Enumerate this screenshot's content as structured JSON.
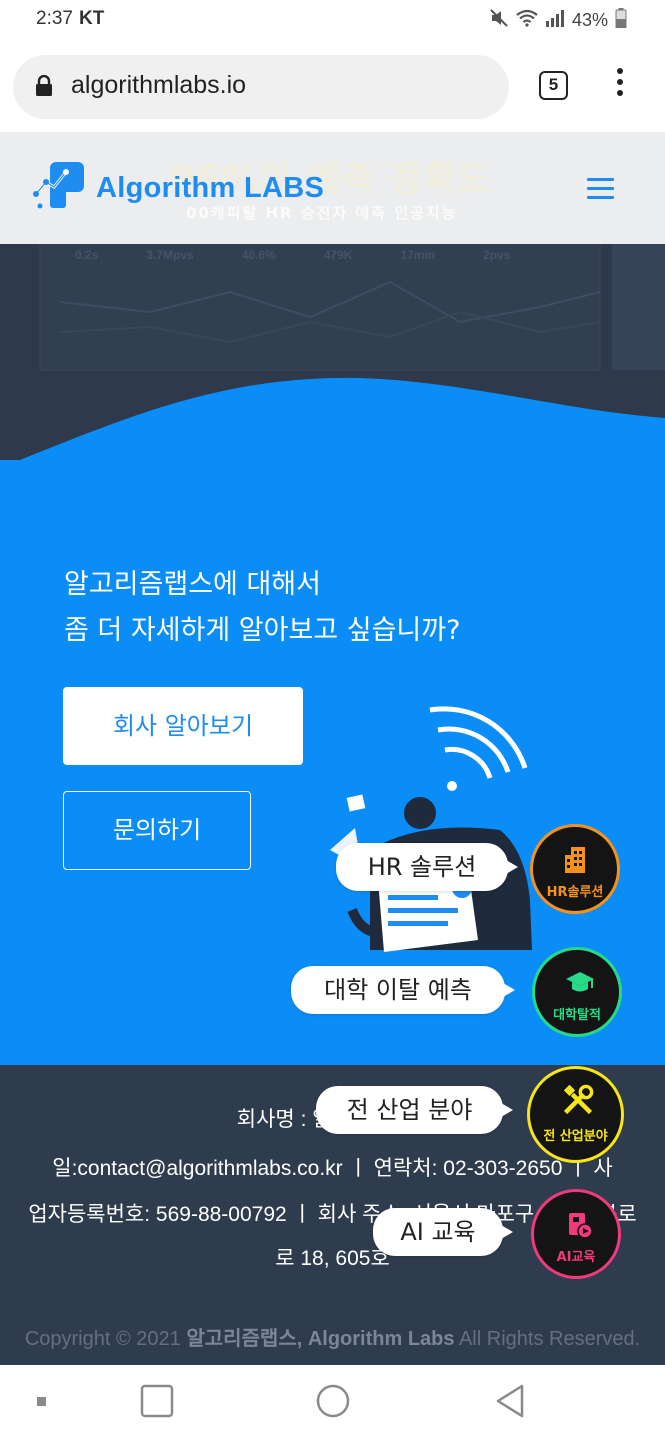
{
  "status_bar": {
    "time": "2:37",
    "carrier": "KT",
    "battery": "43%"
  },
  "browser": {
    "url": "algorithmlabs.io",
    "tab_count": "5"
  },
  "header": {
    "logo_text": "Algorithm LABS",
    "ghost_headline": "96%의 예측 정확도",
    "ghost_subtitle": "00캐피탈 HR 승진자 예측 인공지능",
    "bg_stats": [
      "0.2s",
      "3.7Mpvs",
      "40.6%",
      "479K",
      "17min",
      "2pvs"
    ]
  },
  "about": {
    "line1": "알고리즘랩스에 대해서",
    "line2": "좀 더 자세하게 알아보고 싶습니까?",
    "about_button": "회사 알아보기",
    "contact_button": "문의하기"
  },
  "floating_menu": [
    {
      "tooltip": "HR 솔루션",
      "label": "HR솔루션",
      "icon": "building-icon",
      "color": "#f5921f"
    },
    {
      "tooltip": "대학 이탈 예측",
      "label": "대학탈적",
      "icon": "graduation-cap-icon",
      "color": "#28d988"
    },
    {
      "tooltip": "전 산업 분야",
      "label": "전 산업분야",
      "icon": "tools-icon",
      "color": "#f7e51a"
    },
    {
      "tooltip": "AI 교육",
      "label": "AI교육",
      "icon": "ai-video-icon",
      "color": "#ef3a7b"
    }
  ],
  "footer": {
    "line1": "회사명 : 알고리즘랩스",
    "line2": "일:contact@algorithmlabs.co.kr  ㅣ 연락처: 02-303-2650  ㅣ 사",
    "line3": "업자등록번호: 569-88-00792  ㅣ 회사 주소: 서울시 마포구 월드컵북로",
    "line4": "로 18, 605호",
    "copyright_prefix": "Copyright © 2021 ",
    "copyright_company": "알고리즘랩스, Algorithm Labs",
    "copyright_suffix": " All Rights Reserved."
  },
  "colors": {
    "brand": "#1e8cf0",
    "blue_section": "#0b8df8",
    "footer": "#2f3c4e"
  }
}
